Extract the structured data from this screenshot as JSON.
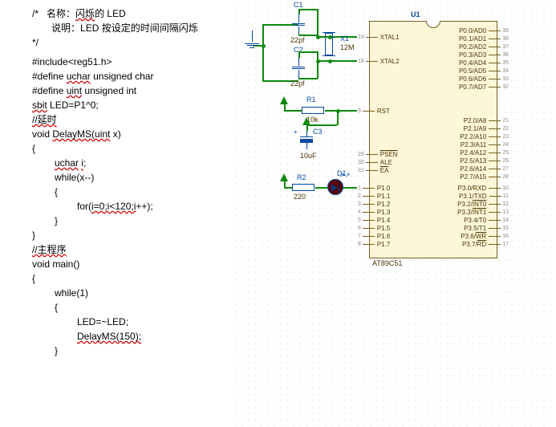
{
  "code": {
    "comment_open": "/*",
    "name_label": "名称：",
    "name_text": "闪烁",
    "name_tail": "的 LED",
    "desc_label": "说明：",
    "desc_text": "LED 按设定的时间间隔闪烁",
    "comment_close": "*/",
    "include": "#include<reg51.h>",
    "define_uchar": "#define",
    "uchar": "uchar",
    "define_uchar_tail": "unsigned char",
    "define_uint": "#define",
    "uint": "uint",
    "define_uint_tail": "unsigned int",
    "sbit": "sbit",
    "sbit_tail": "LED=P1^0;",
    "comment_delay": "//延时",
    "delay_sig_pre": "void",
    "delay_fn": "DelayMS(uint",
    "delay_sig_post": "x)",
    "brace_o": "{",
    "decl_pre": "uchar",
    "decl_var": "i",
    "decl_post": ";",
    "while_x": "while(x--)",
    "for_pre": "for(",
    "for_body": "i=0;i<120;i",
    "for_post": "++);",
    "brace_c": "}",
    "comment_main": "//主程序",
    "main_sig": "void main()",
    "while1": "while(1)",
    "toggle": "LED=~LED;",
    "call_delay": "DelayMS(150);"
  },
  "chip": {
    "ref": "U1",
    "part": "AT89C51",
    "pins_left_top": [
      {
        "num": "19",
        "name": "XTAL1"
      },
      {
        "num": "18",
        "name": "XTAL2"
      }
    ],
    "pin_rst": {
      "num": "9",
      "name": "RST"
    },
    "pins_left_mid": [
      {
        "num": "29",
        "name": "PSEN",
        "inv": true
      },
      {
        "num": "30",
        "name": "ALE"
      },
      {
        "num": "31",
        "name": "EA",
        "inv": true
      }
    ],
    "pins_left_p1": [
      {
        "num": "1",
        "name": "P1.0"
      },
      {
        "num": "2",
        "name": "P1.1"
      },
      {
        "num": "3",
        "name": "P1.2"
      },
      {
        "num": "4",
        "name": "P1.3"
      },
      {
        "num": "5",
        "name": "P1.4"
      },
      {
        "num": "6",
        "name": "P1.5"
      },
      {
        "num": "7",
        "name": "P1.6"
      },
      {
        "num": "8",
        "name": "P1.7"
      }
    ],
    "pins_right_p0": [
      {
        "num": "39",
        "name": "P0.0/AD0"
      },
      {
        "num": "38",
        "name": "P0.1/AD1"
      },
      {
        "num": "37",
        "name": "P0.2/AD2"
      },
      {
        "num": "36",
        "name": "P0.3/AD3"
      },
      {
        "num": "35",
        "name": "P0.4/AD4"
      },
      {
        "num": "34",
        "name": "P0.5/AD5"
      },
      {
        "num": "33",
        "name": "P0.6/AD6"
      },
      {
        "num": "32",
        "name": "P0.7/AD7"
      }
    ],
    "pins_right_p2": [
      {
        "num": "21",
        "name": "P2.0/A8"
      },
      {
        "num": "22",
        "name": "P2.1/A9"
      },
      {
        "num": "23",
        "name": "P2.2/A10"
      },
      {
        "num": "24",
        "name": "P2.3/A11"
      },
      {
        "num": "25",
        "name": "P2.4/A12"
      },
      {
        "num": "26",
        "name": "P2.5/A13"
      },
      {
        "num": "27",
        "name": "P2.6/A14"
      },
      {
        "num": "28",
        "name": "P2.7/A15"
      }
    ],
    "pins_right_p3": [
      {
        "num": "10",
        "name": "P3.0/RXD"
      },
      {
        "num": "11",
        "name": "P3.1/TXD"
      },
      {
        "num": "12",
        "name": "P3.2/INT0",
        "inv_tail": true
      },
      {
        "num": "13",
        "name": "P3.3/INT1",
        "inv_tail": true
      },
      {
        "num": "14",
        "name": "P3.4/T0"
      },
      {
        "num": "15",
        "name": "P3.5/T1"
      },
      {
        "num": "16",
        "name": "P3.6/WR",
        "inv_tail": true
      },
      {
        "num": "17",
        "name": "P3.7/RD",
        "inv_tail": true
      }
    ]
  },
  "components": {
    "C1": {
      "ref": "C1",
      "val": "22pf"
    },
    "C2": {
      "ref": "C2",
      "val": "22pf"
    },
    "C3": {
      "ref": "C3",
      "val": "10uF"
    },
    "X1": {
      "ref": "X1",
      "val": "12M"
    },
    "R1": {
      "ref": "R1",
      "val": "10k"
    },
    "R2": {
      "ref": "R2",
      "val": "220"
    },
    "D1": {
      "ref": "D1"
    }
  }
}
